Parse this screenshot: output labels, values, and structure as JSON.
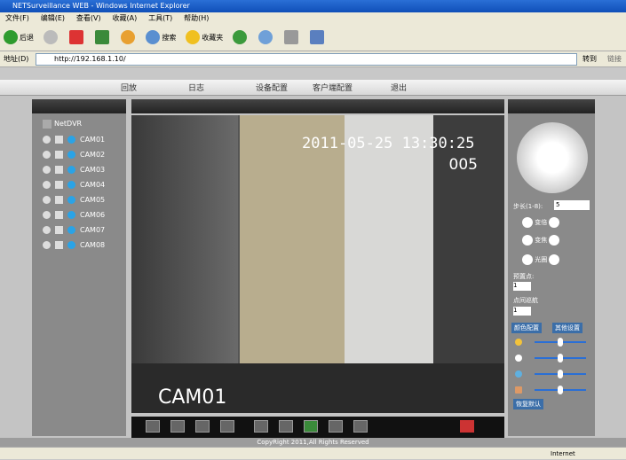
{
  "window": {
    "title": "NETSurveillance WEB - Windows Internet Explorer"
  },
  "menu": [
    "文件(F)",
    "编辑(E)",
    "查看(V)",
    "收藏(A)",
    "工具(T)",
    "帮助(H)"
  ],
  "toolbar": {
    "back": "后退",
    "search": "搜索",
    "favorites": "收藏夹"
  },
  "address": {
    "label": "地址(D)",
    "url": "http://192.168.1.10/",
    "go": "转到",
    "links": "链接"
  },
  "nav": [
    "回放",
    "日志",
    "设备配置",
    "客户端配置",
    "退出"
  ],
  "tree": {
    "root": "NetDVR",
    "cams": [
      "CAM01",
      "CAM02",
      "CAM03",
      "CAM04",
      "CAM05",
      "CAM06",
      "CAM07",
      "CAM08"
    ]
  },
  "video": {
    "timestamp": "2011-05-25 13:30:25",
    "channel": "005",
    "cam": "CAM01"
  },
  "ptz": {
    "step_label": "步长(1-8):",
    "step": "5",
    "zoom": "变倍",
    "focus": "变焦",
    "iris": "光圈",
    "preset": "预置点:",
    "preset_val": "1",
    "cruise": "点间巡航",
    "cruise_val": "1",
    "tab1": "颜色配置",
    "tab2": "其他设置",
    "reset": "恢复默认"
  },
  "footer": "CopyRight 2011,All Rights Reserved",
  "status": "Internet"
}
